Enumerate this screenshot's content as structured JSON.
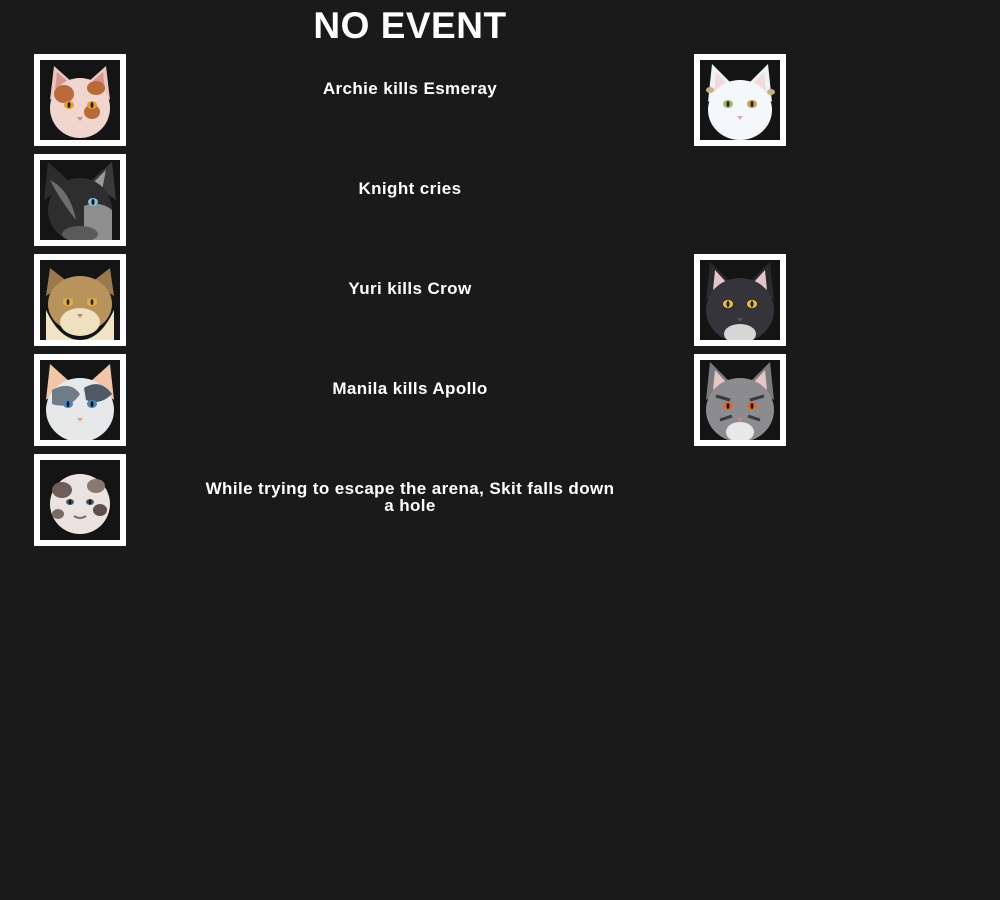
{
  "title": "NO EVENT",
  "events": [
    {
      "text": "Archie kills Esmeray",
      "left_avatar": "cat-avatar-icon",
      "right_avatar": "cat-avatar-icon"
    },
    {
      "text": "Knight cries",
      "left_avatar": "cat-avatar-icon",
      "right_avatar": null
    },
    {
      "text": "Yuri kills Crow",
      "left_avatar": "cat-avatar-icon",
      "right_avatar": "cat-avatar-icon"
    },
    {
      "text": "Manila kills Apollo",
      "left_avatar": "cat-avatar-icon",
      "right_avatar": "cat-avatar-icon"
    },
    {
      "text": "While trying to escape the arena, Skit falls down a hole",
      "left_avatar": "cat-avatar-icon",
      "right_avatar": null
    }
  ],
  "colors": {
    "background": "#1a1a1a",
    "text": "#ffffff",
    "frame": "#ffffff"
  }
}
